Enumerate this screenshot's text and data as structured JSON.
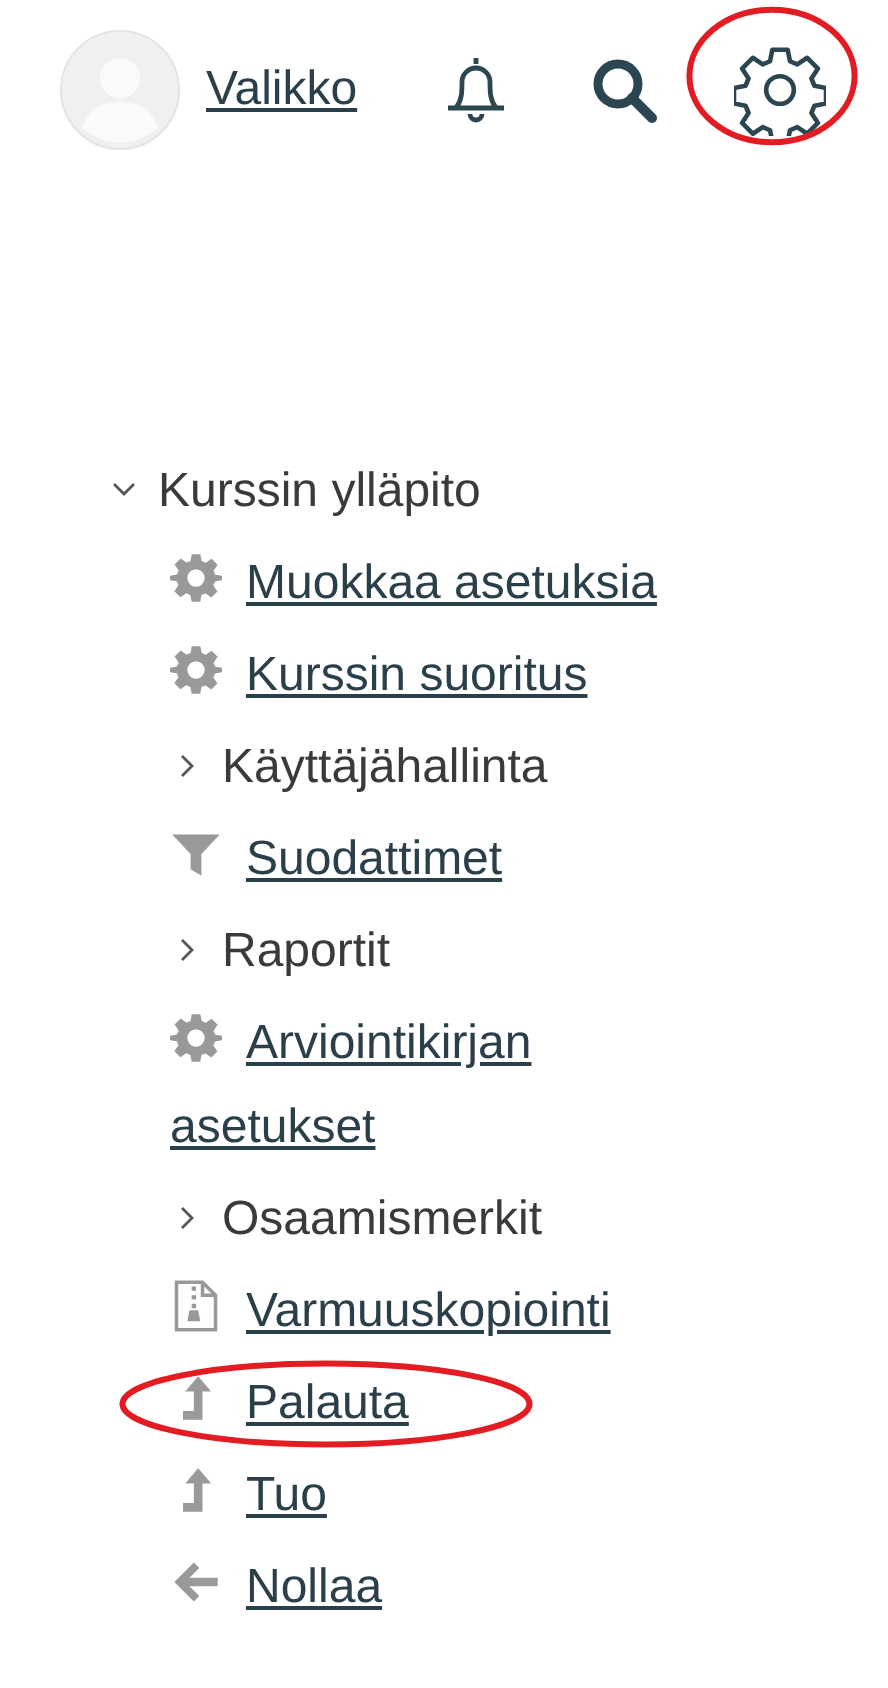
{
  "header": {
    "menu_link": "Valikko",
    "settings_highlighted": true
  },
  "tree": {
    "label": "Kurssin ylläpito",
    "expanded": true,
    "children": [
      {
        "kind": "settings",
        "label": "Muokkaa asetuksia",
        "highlighted": false
      },
      {
        "kind": "settings",
        "label": "Kurssin suoritus",
        "highlighted": false
      },
      {
        "kind": "branch",
        "label": "Käyttäjähallinta",
        "highlighted": false
      },
      {
        "kind": "filter",
        "label": "Suodattimet",
        "highlighted": false
      },
      {
        "kind": "branch",
        "label": "Raportit",
        "highlighted": false
      },
      {
        "kind": "settings",
        "label": "Arviointikirjan asetukset",
        "highlighted": false
      },
      {
        "kind": "branch",
        "label": "Osaamismerkit",
        "highlighted": false
      },
      {
        "kind": "backup",
        "label": "Varmuuskopiointi",
        "highlighted": false
      },
      {
        "kind": "restore",
        "label": "Palauta",
        "highlighted": true
      },
      {
        "kind": "import",
        "label": "Tuo",
        "highlighted": false
      },
      {
        "kind": "reset",
        "label": "Nollaa",
        "highlighted": false
      }
    ]
  }
}
